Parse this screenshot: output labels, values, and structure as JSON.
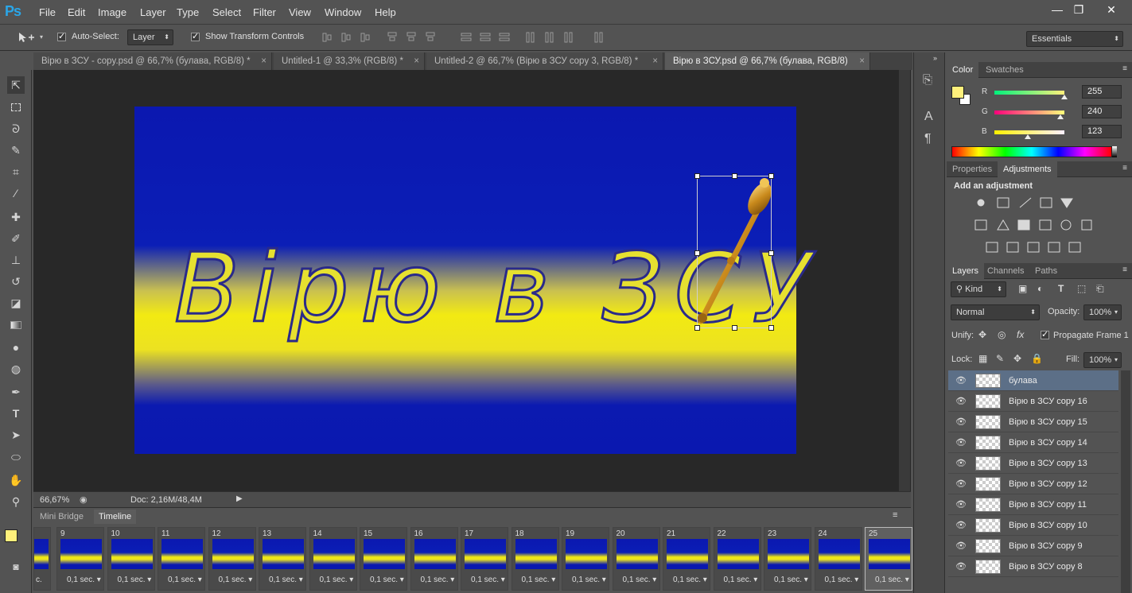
{
  "app": {
    "logo": "Ps"
  },
  "menu": [
    "File",
    "Edit",
    "Image",
    "Layer",
    "Type",
    "Select",
    "Filter",
    "View",
    "Window",
    "Help"
  ],
  "window_controls": {
    "minimize": "—",
    "restore": "❐",
    "close": "✕"
  },
  "options": {
    "auto_select_label": "Auto-Select:",
    "auto_select_value": "Layer",
    "show_transform_label": "Show Transform Controls",
    "workspace": "Essentials"
  },
  "tabs": [
    {
      "label": "Вірю в ЗСУ - copy.psd @ 66,7% (булава, RGB/8) *",
      "active": false
    },
    {
      "label": "Untitled-1 @ 33,3% (RGB/8) *",
      "active": false
    },
    {
      "label": "Untitled-2 @ 66,7% (Вірю в ЗСУ copy 3, RGB/8) *",
      "active": false
    },
    {
      "label": "Вірю в ЗСУ.psd @ 66,7% (булава, RGB/8)",
      "active": true
    }
  ],
  "canvas": {
    "text": "Вірю в ЗСУ"
  },
  "status": {
    "zoom": "66,67%",
    "doc": "Doc: 2,16M/48,4M"
  },
  "timeline": {
    "tabs": [
      "Mini Bridge",
      "Timeline"
    ],
    "active_tab": "Timeline",
    "frames": [
      {
        "num": "9",
        "delay": "0,1 sec."
      },
      {
        "num": "10",
        "delay": "0,1 sec."
      },
      {
        "num": "11",
        "delay": "0,1 sec."
      },
      {
        "num": "12",
        "delay": "0,1 sec."
      },
      {
        "num": "13",
        "delay": "0,1 sec."
      },
      {
        "num": "14",
        "delay": "0,1 sec."
      },
      {
        "num": "15",
        "delay": "0,1 sec."
      },
      {
        "num": "16",
        "delay": "0,1 sec."
      },
      {
        "num": "17",
        "delay": "0,1 sec."
      },
      {
        "num": "18",
        "delay": "0,1 sec."
      },
      {
        "num": "19",
        "delay": "0,1 sec."
      },
      {
        "num": "20",
        "delay": "0,1 sec."
      },
      {
        "num": "21",
        "delay": "0,1 sec."
      },
      {
        "num": "22",
        "delay": "0,1 sec."
      },
      {
        "num": "23",
        "delay": "0,1 sec."
      },
      {
        "num": "24",
        "delay": "0,1 sec."
      },
      {
        "num": "25",
        "delay": "0,1 sec."
      }
    ],
    "selected_frame": "25",
    "partial_delay": "c."
  },
  "color_panel": {
    "tabs": [
      "Color",
      "Swatches"
    ],
    "fg_color": "#fff07b",
    "r_label": "R",
    "g_label": "G",
    "b_label": "B",
    "r": "255",
    "g": "240",
    "b": "123"
  },
  "adjustments": {
    "tabs": [
      "Properties",
      "Adjustments"
    ],
    "title": "Add an adjustment"
  },
  "layers_panel": {
    "tabs": [
      "Layers",
      "Channels",
      "Paths"
    ],
    "kind": "Kind",
    "blend": "Normal",
    "opacity_label": "Opacity:",
    "opacity": "100%",
    "unify_label": "Unify:",
    "propagate_label": "Propagate Frame 1",
    "lock_label": "Lock:",
    "fill_label": "Fill:",
    "fill": "100%",
    "layers": [
      {
        "name": "булава",
        "selected": true
      },
      {
        "name": "Вірю в ЗСУ copy 16",
        "selected": false
      },
      {
        "name": "Вірю в ЗСУ copy 15",
        "selected": false
      },
      {
        "name": "Вірю в ЗСУ copy 14",
        "selected": false
      },
      {
        "name": "Вірю в ЗСУ copy 13",
        "selected": false
      },
      {
        "name": "Вірю в ЗСУ copy 12",
        "selected": false
      },
      {
        "name": "Вірю в ЗСУ copy 11",
        "selected": false
      },
      {
        "name": "Вірю в ЗСУ copy 10",
        "selected": false
      },
      {
        "name": "Вірю в ЗСУ copy 9",
        "selected": false
      },
      {
        "name": "Вірю в ЗСУ copy 8",
        "selected": false
      }
    ]
  }
}
